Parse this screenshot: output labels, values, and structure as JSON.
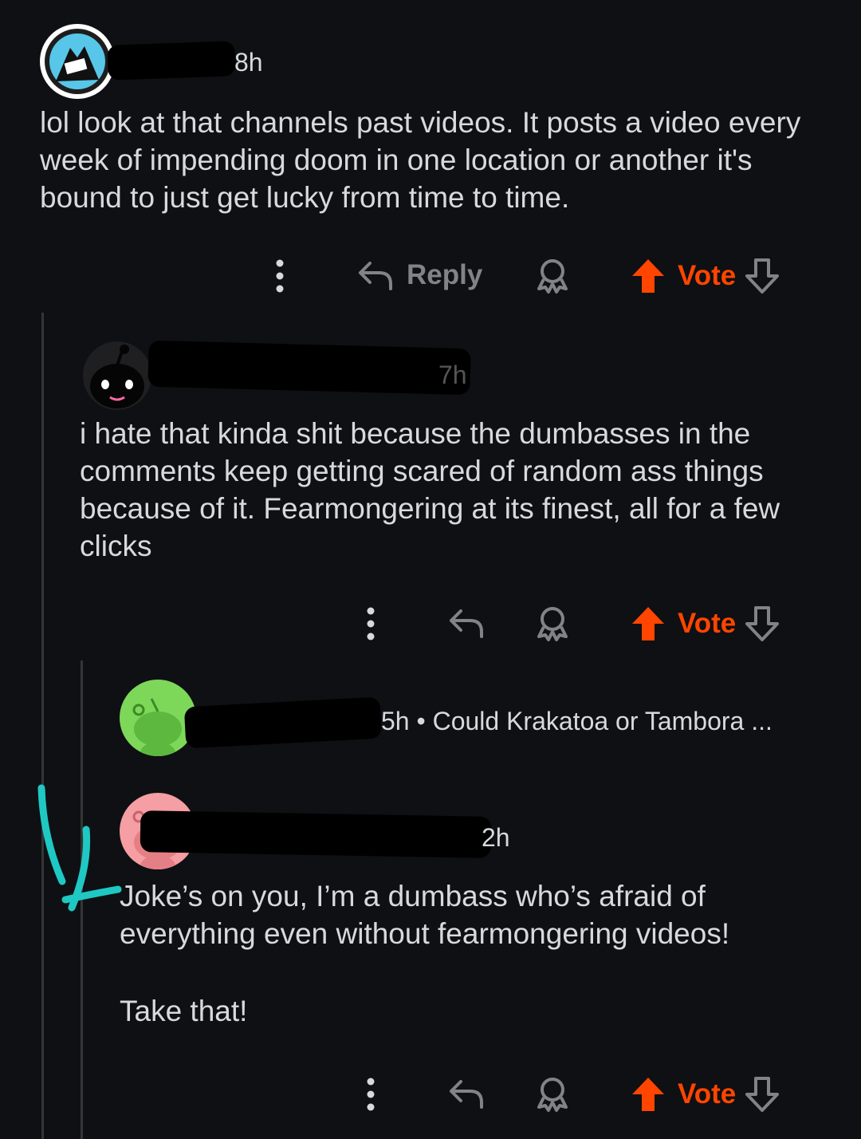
{
  "comments": [
    {
      "time": "8h",
      "body": "lol look at that channels past videos. It posts a video every week of impending doom in one location or another it's bound to just get lucky from time to time.",
      "reply_label": "Reply",
      "vote_label": "Vote"
    },
    {
      "time": "7h",
      "body": "i hate that kinda shit because the dumbasses in the comments keep getting scared of random ass things because of it. Fearmongering at its finest, all for a few clicks",
      "vote_label": "Vote"
    },
    {
      "time": "5h",
      "collapsed_preview": "5h • Could Krakatoa or Tambora ..."
    },
    {
      "time": "2h",
      "body_lines": [
        "Joke’s on you, I’m a dumbass who’s afraid of",
        "everything even without fearmongering videos!"
      ],
      "body_2": "Take that!",
      "vote_label": "Vote"
    }
  ],
  "colors": {
    "background": "#0e1013",
    "text": "#d7dadc",
    "muted": "#818384",
    "upvote": "#ff4500",
    "annotation_arrow": "#1fc8c2"
  },
  "icons": [
    "more-icon",
    "reply-icon",
    "award-icon",
    "upvote-icon",
    "downvote-icon"
  ]
}
